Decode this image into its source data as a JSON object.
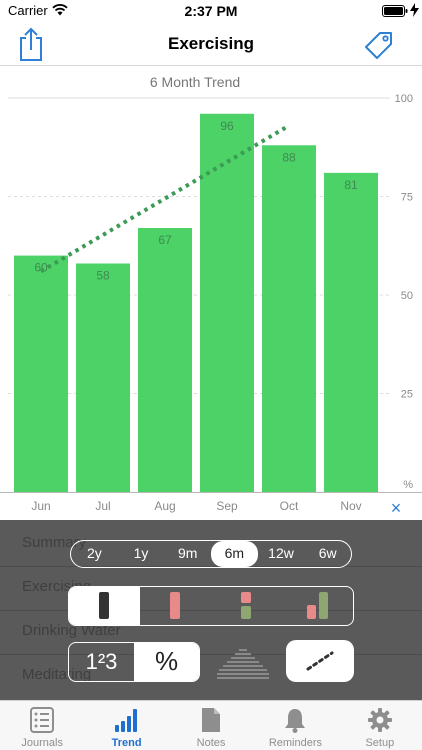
{
  "status_bar": {
    "carrier": "Carrier",
    "time": "2:37 PM"
  },
  "nav": {
    "title": "Exercising",
    "left_icon": "share-icon",
    "right_icon": "tag-icon"
  },
  "colors": {
    "accent": "#2f7fd6",
    "bar": "#4cd266",
    "trend": "#3d9a55",
    "panel": "#5a5a5a",
    "pink": "#e88a8a",
    "olive": "#8fa672"
  },
  "chart_data": {
    "type": "bar",
    "title": "6 Month Trend",
    "categories": [
      "Jun",
      "Jul",
      "Aug",
      "Sep",
      "Oct",
      "Nov"
    ],
    "values": [
      60,
      58,
      67,
      96,
      88,
      81
    ],
    "ylim": [
      0,
      100
    ],
    "yticks": [
      "100",
      "75",
      "50",
      "25",
      "%"
    ],
    "ytick_values": [
      100,
      75,
      50,
      25,
      0
    ],
    "grid": true,
    "trend_line": {
      "style": "dotted",
      "from": {
        "category": "Jun",
        "value": 56
      },
      "to": {
        "category": "Oct",
        "value": 93
      }
    }
  },
  "close_label": "×",
  "background_list": [
    "Summary",
    "Exercising",
    "Drinking Water",
    "Meditating"
  ],
  "period_options": [
    "2y",
    "1y",
    "9m",
    "6m",
    "12w",
    "6w"
  ],
  "period_selected": 3,
  "bar_style_selected": 0,
  "format_options": [
    "1²3",
    "%"
  ],
  "format_selected": 1,
  "tabs": [
    {
      "label": "Journals",
      "icon": "list-icon"
    },
    {
      "label": "Trend",
      "icon": "bar-chart-icon"
    },
    {
      "label": "Notes",
      "icon": "document-icon"
    },
    {
      "label": "Reminders",
      "icon": "bell-icon"
    },
    {
      "label": "Setup",
      "icon": "gear-icon"
    }
  ],
  "active_tab": 1
}
